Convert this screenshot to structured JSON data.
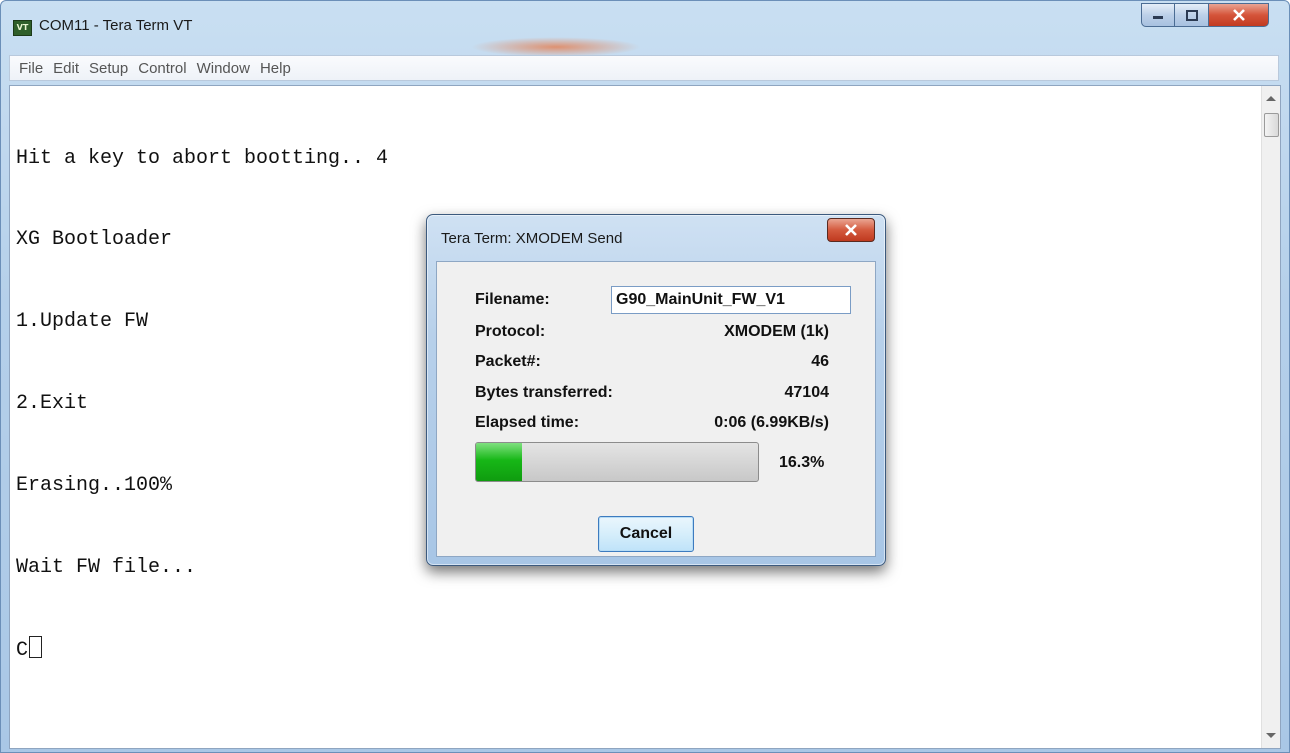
{
  "window": {
    "title": "COM11 - Tera Term VT",
    "icon_text": "VT"
  },
  "menu": [
    "File",
    "Edit",
    "Setup",
    "Control",
    "Window",
    "Help"
  ],
  "terminal": {
    "lines": [
      "Hit a key to abort bootting.. 4",
      "XG Bootloader",
      "1.Update FW",
      "2.Exit",
      "Erasing..100%",
      "Wait FW file...",
      "C"
    ]
  },
  "dialog": {
    "title": "Tera Term: XMODEM Send",
    "filename_label": "Filename:",
    "filename_value": "G90_MainUnit_FW_V1",
    "protocol_label": "Protocol:",
    "protocol_value": "XMODEM (1k)",
    "packet_label": "Packet#:",
    "packet_value": "46",
    "bytes_label": "Bytes transferred:",
    "bytes_value": "47104",
    "elapsed_label": "Elapsed time:",
    "elapsed_value": "0:06 (6.99KB/s)",
    "progress_percent": 16.3,
    "progress_text": "16.3%",
    "cancel_label": "Cancel"
  },
  "colors": {
    "progress_fill": "#17b717",
    "close_button": "#d45a3e"
  }
}
